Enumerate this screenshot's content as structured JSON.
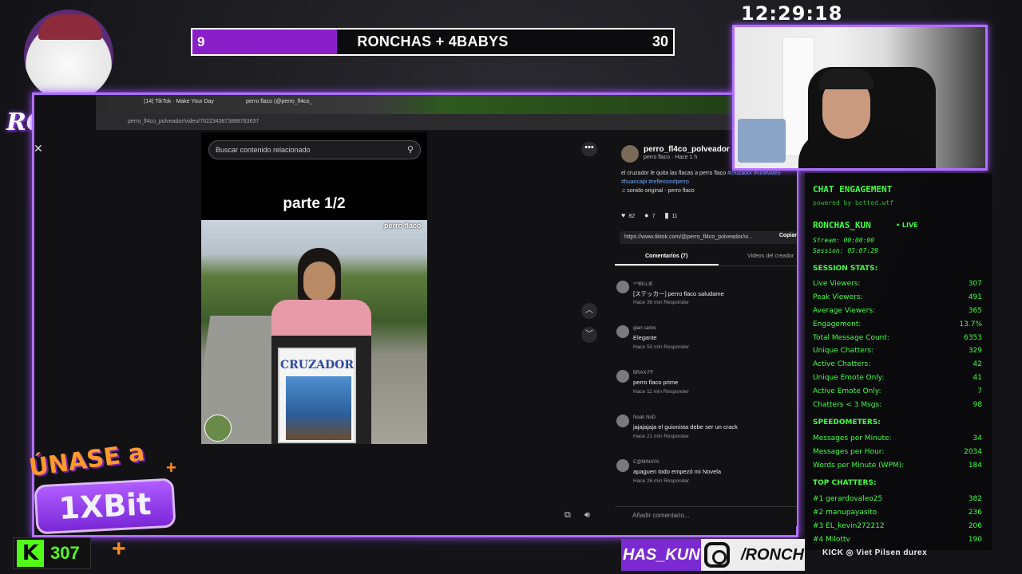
{
  "clock": "12:29:18",
  "scoreboard": {
    "left_score": "9",
    "title": "RONCHAS + 4BABYS",
    "right_score": "30",
    "left_fill_fraction": 0.3,
    "accent": "#8a1fc9"
  },
  "branding": {
    "logo_text": "RONCHAS",
    "kick_count": "307",
    "promo_line1": "ÚNASE a",
    "promo_brand": "1XBit",
    "promo_strip_left": "HAS_KUN",
    "promo_strip_right": "/RONCH",
    "sponsors": "KICK  ◎  Viet  Pilsen  durex"
  },
  "browser": {
    "tabs": [
      "(14) TikTok · Make Your Day",
      "perro flaco (@perro_fl4co_"
    ],
    "url": "perro_fl4co_polveador/video/7622343873888783637",
    "search_placeholder": "Buscar contenido relacionado",
    "video_caption": "parte 1/2",
    "watermark": "perro flaco",
    "sign_text": "CRUZADOR"
  },
  "post": {
    "username": "perro_fl4co_polveador",
    "sub": "perro flaco · Hace 1 h",
    "description": "el cruzador le quita las flacas a perro flaco",
    "hashtags": "#cruzador #viralvideo #huancapi #reflexion#perro",
    "music": "♫  sonido original - perro flaco",
    "likes": "82",
    "comments": "7",
    "saves": "11",
    "link": "https://www.tiktok.com/@perro_fl4co_polveador/vi...",
    "copy_label": "Copiar",
    "tab_comments": "Comentarios (7)",
    "tab_videos": "Videos del creador",
    "add_comment_placeholder": "Añadir comentario..."
  },
  "comments": [
    {
      "name": "⁵⁰³BILLIE",
      "text": "[ステッカー] perro flaco saludame",
      "meta": "Hace 36 min    Responder"
    },
    {
      "name": "gian carlos",
      "text": "Elegante",
      "meta": "Hace 50 min    Responder"
    },
    {
      "name": "BRAX FF",
      "text": "perro flaco prime",
      "meta": "Hace 11 min    Responder"
    },
    {
      "name": "Noah NoD",
      "text": "jajajajaja el guionista debe ser un crack",
      "meta": "Hace 21 min    Responder"
    },
    {
      "name": "C@MINAYA",
      "text": "apaguen todo empezó mi Novela",
      "meta": "Hace 26 min    Responder"
    }
  ],
  "engagement": {
    "title": "CHAT ENGAGEMENT",
    "powered": "powered by botted.wtf",
    "user": "RONCHAS_KUN",
    "live": "• LIVE",
    "stream": "Stream: 00:00:00",
    "session": "Session: 03:07:29",
    "session_stats_label": "SESSION STATS:",
    "stats": [
      {
        "label": "Live Viewers:",
        "value": "307"
      },
      {
        "label": "Peak Viewers:",
        "value": "491"
      },
      {
        "label": "Average Viewers:",
        "value": "365"
      },
      {
        "label": "Engagement:",
        "value": "13.7%"
      },
      {
        "label": "Total Message Count:",
        "value": "6353"
      },
      {
        "label": "Unique Chatters:",
        "value": "329"
      },
      {
        "label": "Active Chatters:",
        "value": "42"
      },
      {
        "label": "Unique Emote Only:",
        "value": "41"
      },
      {
        "label": "Active Emote Only:",
        "value": "7"
      },
      {
        "label": "Chatters < 3 Msgs:",
        "value": "98"
      }
    ],
    "speed_label": "SPEEDOMETERS:",
    "speed": [
      {
        "label": "Messages per Minute:",
        "value": "34"
      },
      {
        "label": "Messages per Hour:",
        "value": "2034"
      },
      {
        "label": "Words per Minute (WPM):",
        "value": "184"
      }
    ],
    "top_label": "TOP CHATTERS:",
    "top": [
      {
        "label": "#1 gerardovaleo25",
        "value": "382"
      },
      {
        "label": "#2 manupayasito",
        "value": "236"
      },
      {
        "label": "#3 EL_kevin272212",
        "value": "206"
      },
      {
        "label": "#4 Milottv",
        "value": "190"
      }
    ]
  }
}
